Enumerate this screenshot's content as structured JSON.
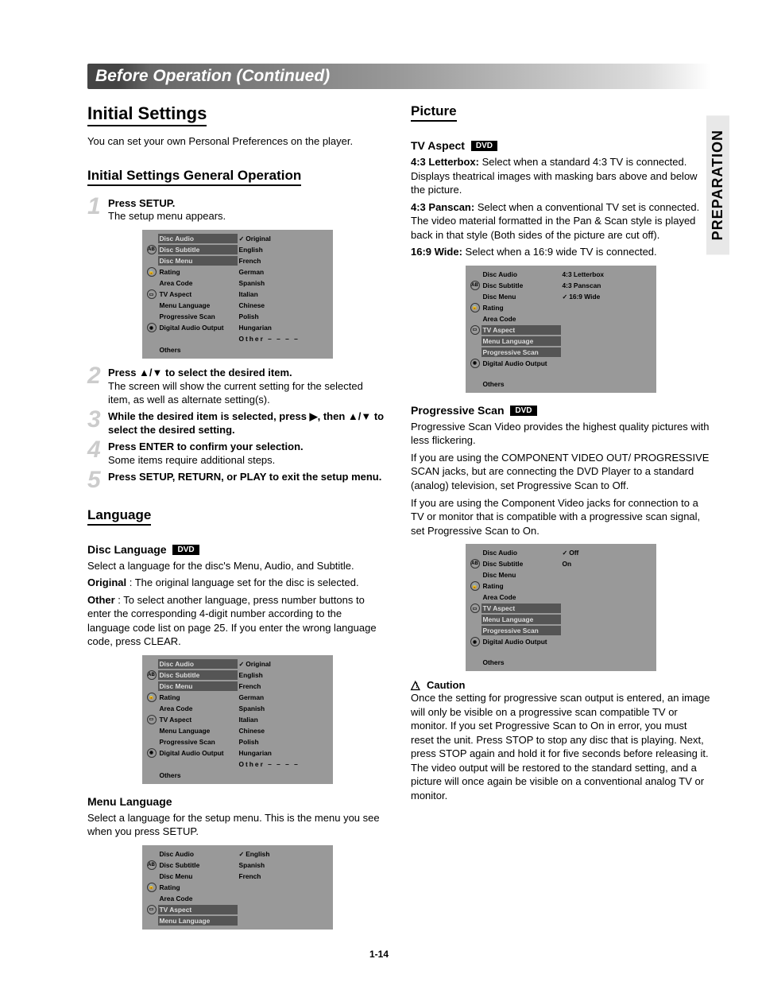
{
  "side_tab": "PREPARATION",
  "banner": "Before Operation (Continued)",
  "page_num": "1-14",
  "left": {
    "h1": "Initial Settings",
    "intro": "You can set your own Personal Preferences on the player.",
    "h2_general": "Initial Settings General Operation",
    "steps": [
      {
        "n": "1",
        "bold": "Press SETUP.",
        "rest": "The setup menu appears."
      },
      {
        "n": "2",
        "bold": "Press ▲/▼ to select the desired item.",
        "rest": "The screen will show the current setting for the selected item, as well as alternate setting(s)."
      },
      {
        "n": "3",
        "bold": "While the desired item is selected, press ▶, then ▲/▼ to select the desired setting.",
        "rest": ""
      },
      {
        "n": "4",
        "bold": "Press ENTER to confirm your selection.",
        "rest": "Some items require additional steps."
      },
      {
        "n": "5",
        "bold": "Press SETUP, RETURN, or PLAY to exit the setup menu.",
        "rest": ""
      }
    ],
    "h2_lang": "Language",
    "disc_lang_h": "Disc Language",
    "disc_lang_p1": "Select a language for the disc's Menu, Audio, and Subtitle.",
    "disc_lang_original_label": "Original",
    "disc_lang_original_desc": " : The original language set for the disc is selected.",
    "disc_lang_other_label": "Other",
    "disc_lang_other_desc": " : To select another language, press number buttons to enter the corresponding 4-digit number according to the language code list on page 25. If you enter the wrong language code, press CLEAR.",
    "menu_lang_h": "Menu Language",
    "menu_lang_p": "Select a language for the setup menu. This is the menu you see when you press SETUP."
  },
  "right": {
    "h2_picture": "Picture",
    "tv_aspect_h": "TV Aspect",
    "aspect_43lb_label": "4:3 Letterbox:",
    "aspect_43lb_desc": " Select when a standard 4:3 TV is connected. Displays theatrical images with masking bars above and below the picture.",
    "aspect_43ps_label": "4:3 Panscan:",
    "aspect_43ps_desc": " Select when a conventional TV set is connected. The video material formatted in the Pan & Scan style is played back in that style (Both sides of the picture are cut off).",
    "aspect_169_label": "16:9 Wide:",
    "aspect_169_desc": " Select when a 16:9 wide TV is connected.",
    "prog_h": "Progressive Scan",
    "prog_p1": "Progressive Scan Video provides the highest quality pictures with less flickering.",
    "prog_p2": "If you are using the COMPONENT VIDEO OUT/ PROGRESSIVE SCAN jacks, but are connecting the DVD Player to a standard (analog) television, set Progressive Scan to Off.",
    "prog_p3": "If you are using the Component Video jacks for connection to a TV or monitor that is compatible with a progressive scan signal, set Progressive Scan to On.",
    "caution_h": "Caution",
    "caution_p": "Once the setting for progressive scan output is entered, an image will only be visible on a progressive scan compatible TV or monitor. If you set Progressive Scan to On in error, you must reset the unit. Press STOP to stop any disc that is playing. Next, press STOP again and hold it for five seconds before releasing it. The video output will be restored to the standard setting, and a picture will once again be visible on a conventional analog TV or monitor."
  },
  "dvd_badge": "DVD",
  "menus": {
    "left_items": [
      "Disc Audio",
      "Disc Subtitle",
      "Disc Menu",
      "Rating",
      "Area Code",
      "TV Aspect",
      "Menu Language",
      "Progressive Scan",
      "Digital Audio Output",
      "Others"
    ],
    "lang_options": [
      "Original",
      "English",
      "French",
      "German",
      "Spanish",
      "Italian",
      "Chinese",
      "Polish",
      "Hungarian",
      "Other  – – – –"
    ],
    "menu_lang_options": [
      "English",
      "Spanish",
      "French"
    ],
    "aspect_options": [
      "4:3   Letterbox",
      "4:3   Panscan",
      "16:9 Wide"
    ],
    "prog_options": [
      "Off",
      "On"
    ]
  }
}
